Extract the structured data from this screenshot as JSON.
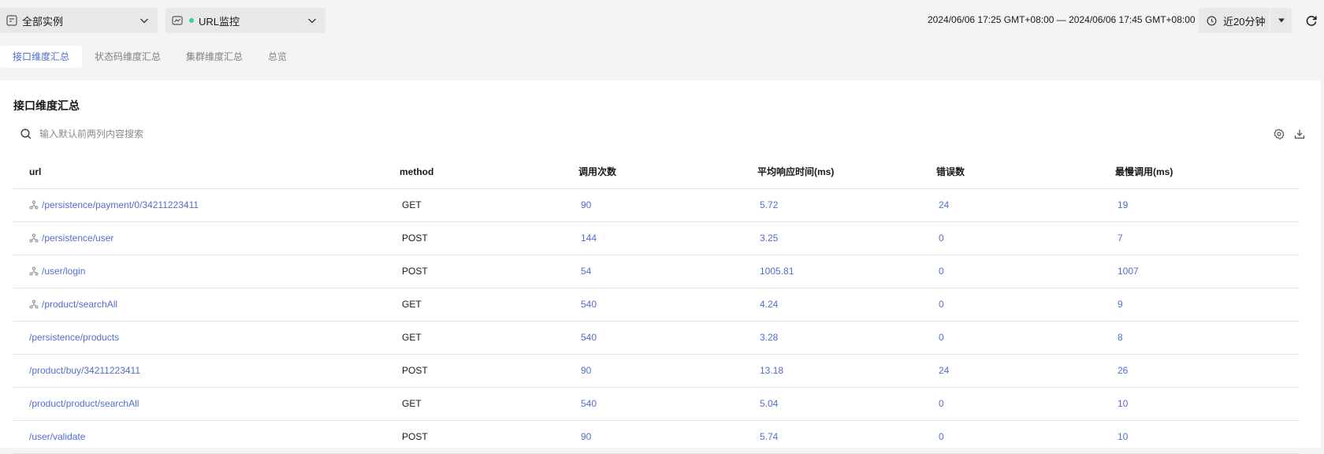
{
  "header": {
    "instance_select": "全部实例",
    "monitor_select": "URL监控",
    "monitor_dot_color": "#3dcca6",
    "time_range": "2024/06/06 17:25 GMT+08:00 — 2024/06/06 17:45 GMT+08:00",
    "time_picker": "近20分钟"
  },
  "tabs": [
    {
      "label": "接口维度汇总",
      "active": true
    },
    {
      "label": "状态码维度汇总",
      "active": false
    },
    {
      "label": "集群维度汇总",
      "active": false
    },
    {
      "label": "总览",
      "active": false
    }
  ],
  "card": {
    "title": "接口维度汇总",
    "search_placeholder": "输入默认前两列内容搜索"
  },
  "table": {
    "columns": [
      "url",
      "method",
      "调用次数",
      "平均响应时间(ms)",
      "错误数",
      "最慢调用(ms)"
    ],
    "rows": [
      {
        "url": "/persistence/payment/0/34211223411",
        "topology": true,
        "method": "GET",
        "calls": "90",
        "avg": "5.72",
        "errors": "24",
        "slowest": "19"
      },
      {
        "url": "/persistence/user",
        "topology": true,
        "method": "POST",
        "calls": "144",
        "avg": "3.25",
        "errors": "0",
        "slowest": "7"
      },
      {
        "url": "/user/login",
        "topology": true,
        "method": "POST",
        "calls": "54",
        "avg": "1005.81",
        "errors": "0",
        "slowest": "1007"
      },
      {
        "url": "/product/searchAll",
        "topology": true,
        "method": "GET",
        "calls": "540",
        "avg": "4.24",
        "errors": "0",
        "slowest": "9"
      },
      {
        "url": "/persistence/products",
        "topology": false,
        "method": "GET",
        "calls": "540",
        "avg": "3.28",
        "errors": "0",
        "slowest": "8"
      },
      {
        "url": "/product/buy/34211223411",
        "topology": false,
        "method": "POST",
        "calls": "90",
        "avg": "13.18",
        "errors": "24",
        "slowest": "26"
      },
      {
        "url": "/product/product/searchAll",
        "topology": false,
        "method": "GET",
        "calls": "540",
        "avg": "5.04",
        "errors": "0",
        "slowest": "10"
      },
      {
        "url": "/user/validate",
        "topology": false,
        "method": "POST",
        "calls": "90",
        "avg": "5.74",
        "errors": "0",
        "slowest": "10"
      }
    ]
  },
  "colors": {
    "accent": "#526ecc",
    "error": "#e84e40"
  }
}
